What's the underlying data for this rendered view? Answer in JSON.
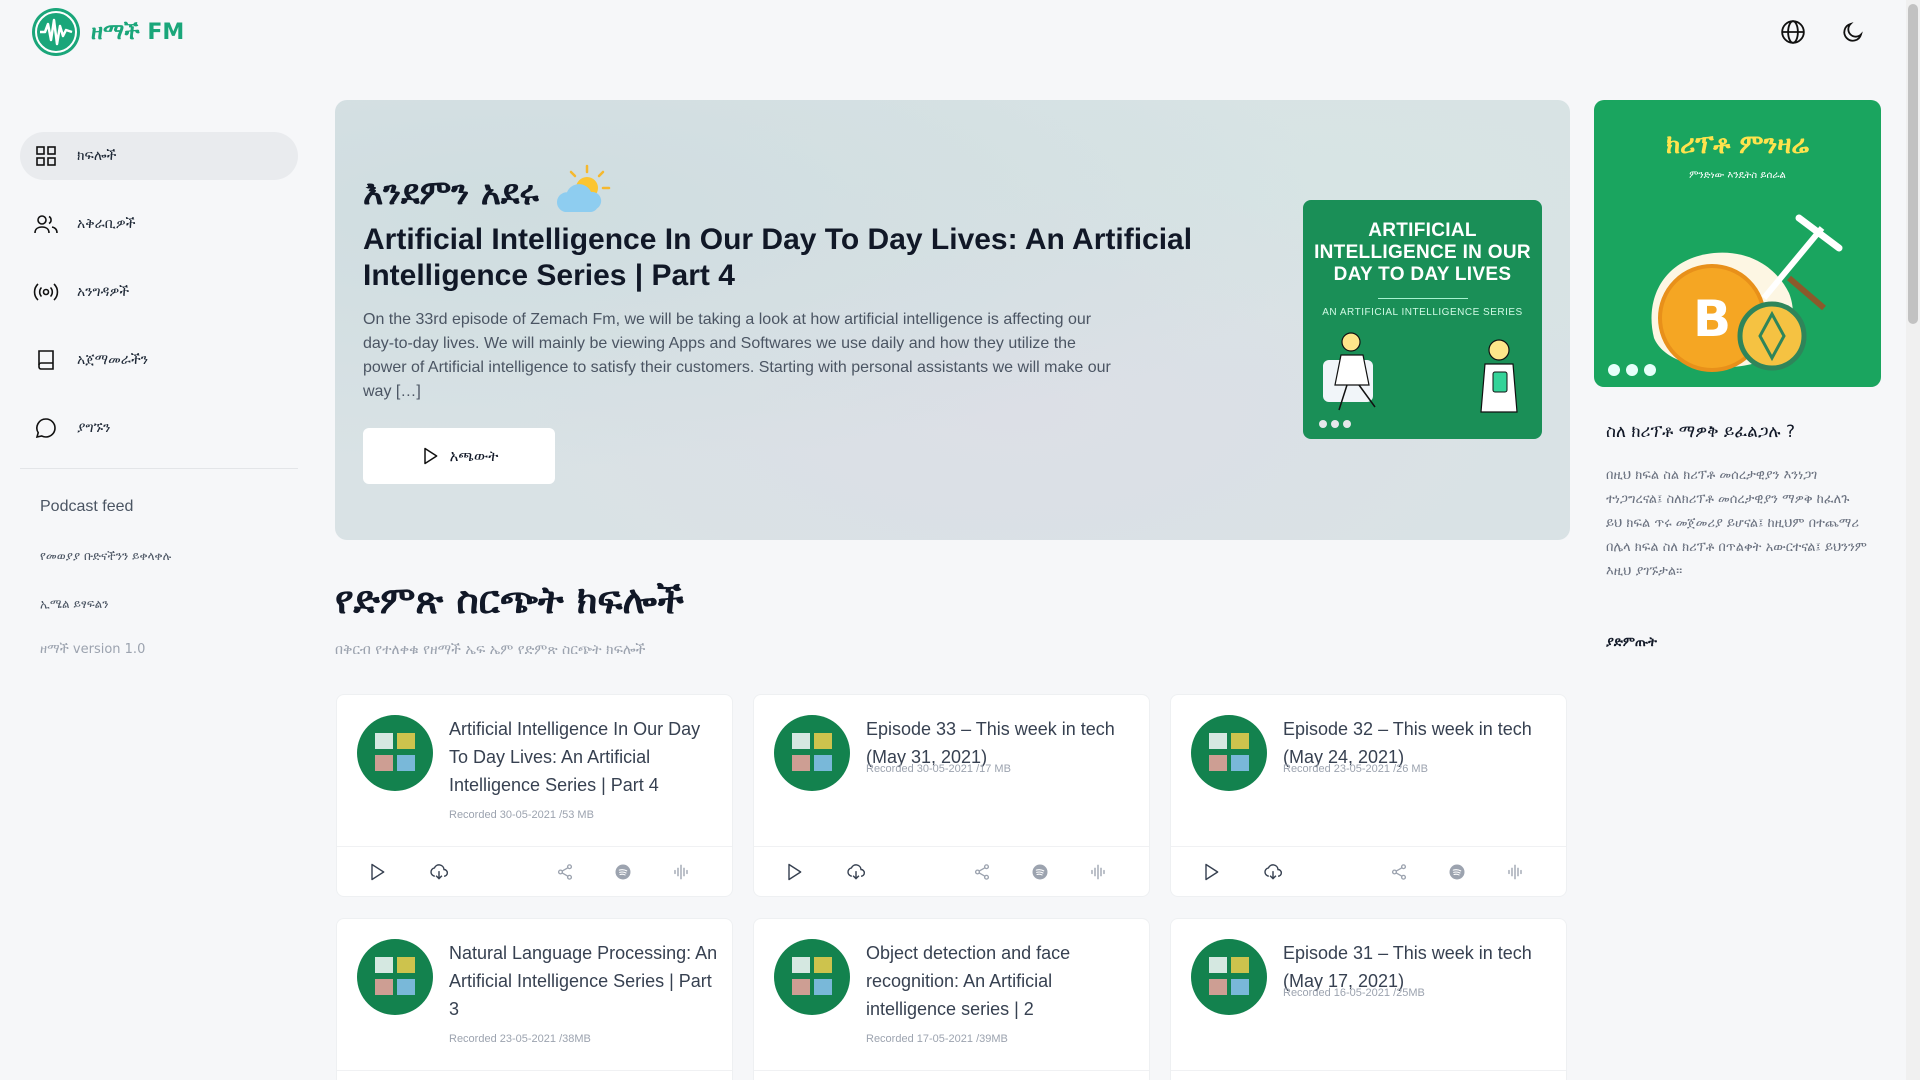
{
  "header": {
    "logo_text": "ዘማች FM"
  },
  "sidebar": {
    "items": [
      {
        "label": "ክፍሎች",
        "icon": "grid-icon",
        "active": true
      },
      {
        "label": "አቅራቢዎች",
        "icon": "users-icon",
        "active": false
      },
      {
        "label": "አንግዳዎች",
        "icon": "broadcast-icon",
        "active": false
      },
      {
        "label": "አጀማመራችን",
        "icon": "book-icon",
        "active": false
      },
      {
        "label": "ያግኙን",
        "icon": "chat-icon",
        "active": false
      }
    ],
    "feed_title": "Podcast feed",
    "feed_links": [
      "የመወያያ ቡድናችንን ይቀላቀሉ",
      "ኢሜል ይፃፍልን"
    ],
    "version": "ዘማች version 1.0"
  },
  "hero": {
    "greeting": "እንደምን አደሩ",
    "title": "Artificial Intelligence In Our Day To Day Lives: An Artificial Intelligence Series | Part 4",
    "description": "On the 33rd episode of Zemach Fm, we will be taking a look at how artificial intelligence is affecting our day-to-day lives. We will mainly be viewing Apps and Softwares we use daily and how they utilize the power of Artificial intelligence to satisfy their customers. Starting with personal assistants we will make our way […]",
    "play_label": "አጫውት",
    "cover": {
      "title": "ARTIFICIAL INTELLIGENCE IN OUR DAY TO DAY LIVES",
      "subtitle": "AN ARTIFICIAL INTELLIGENCE SERIES"
    }
  },
  "right_panel": {
    "promo_title": "ክሪፕቶ ምንዛሬ",
    "promo_subtitle": "ምንድነው እንዴትስ ይሰራል",
    "about_title": "ስለ ክሪፕቶ ማዎቅ ይፈልጋሉ ?",
    "about_text": "በዚህ ክፍል ስል ክሪፕቶ መሰረታዊያን እንነጋገ ተነጋግረናል፤ ስለክሪፕቶ መሰረታዊያን ማዎቅ ከፈለጉ ይህ ክፍል ጥሩ መጀመሪያ ይሆናል፤ ከዚህም በተጨማሪ በሌላ ክፍል ስለ ክሪፕቶ በጥልቀት አውርተናል፤ ይህንንም እዚህ ያገኙታል።",
    "about_link": "ያድምጡት"
  },
  "section": {
    "title": "የድምጽ ስርጭት ክፍሎች",
    "subtitle": "በቅርብ የተለቀቁ የዘማች ኤፍ ኤም የድምጽ ስርጭት ክፍሎች"
  },
  "episodes": [
    {
      "title": "Artificial Intelligence In Our Day To Day Lives: An Artificial Intelligence Series | Part 4",
      "meta": "Recorded 30-05-2021 /53 MB"
    },
    {
      "title": "Episode 33 – This week in tech (May 31, 2021)",
      "meta": "Recorded 30-05-2021 /17 MB"
    },
    {
      "title": "Episode 32 – This week in tech (May 24, 2021)",
      "meta": "Recorded 23-05-2021 /26 MB"
    },
    {
      "title": "Natural Language Processing: An Artificial Intelligence Series | Part 3",
      "meta": "Recorded 23-05-2021 /38MB"
    },
    {
      "title": "Object detection and face recognition: An Artificial intelligence series | 2",
      "meta": "Recorded 17-05-2021 /39MB"
    },
    {
      "title": "Episode 31 – This week in tech (May 17, 2021)",
      "meta": "Recorded 16-05-2021 /25MB"
    }
  ],
  "colors": {
    "brand": "#1aa67a",
    "cover_green": "#13824e",
    "background": "#f6f7f9"
  }
}
